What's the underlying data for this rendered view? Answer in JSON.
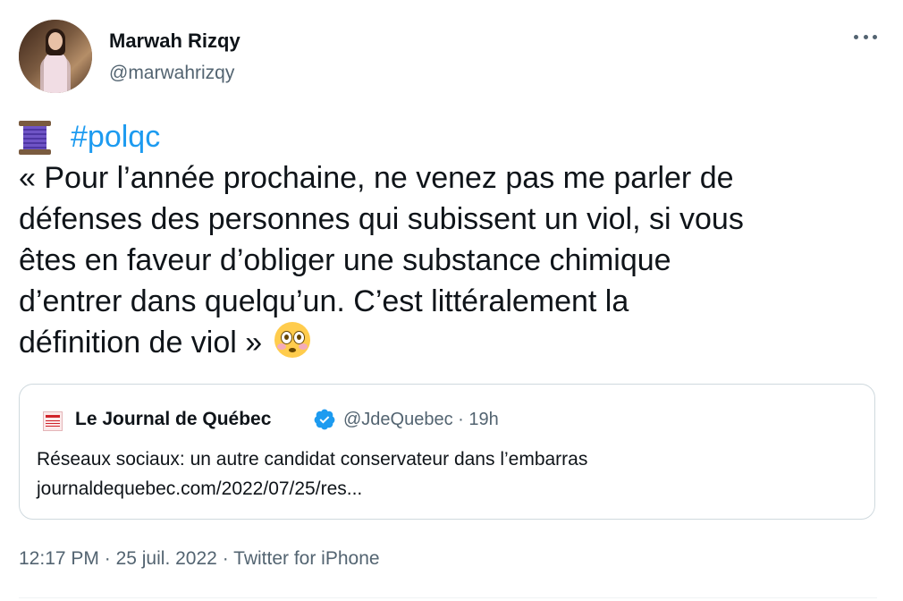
{
  "author": {
    "display_name": "Marwah Rizqy",
    "handle": "@marwahrizqy"
  },
  "tweet": {
    "emoji_lead": "spool-of-thread",
    "hashtag": "#polqc",
    "lines": [
      "« Pour l’année prochaine, ne venez pas me parler de",
      "défenses des personnes qui subissent un viol, si vous",
      "êtes en faveur d’obliger une substance chimique",
      "d’entrer dans quelqu’un. C’est littéralement la",
      "définition de viol »"
    ],
    "emoji_trail": "flushed-face"
  },
  "quote": {
    "name": "Le Journal de Québec",
    "handle": "@JdeQuebec",
    "separator": "·",
    "time": "19h",
    "text": "Réseaux sociaux: un autre candidat conservateur dans l’embarras",
    "link": "journaldequebec.com/2022/07/25/res..."
  },
  "meta": {
    "time": "12:17 PM",
    "sep1": "·",
    "date": "25 juil. 2022",
    "sep2": "·",
    "source": "Twitter for iPhone"
  },
  "colors": {
    "link": "#1d9bf0",
    "text": "#0f1419",
    "secondary": "#536471",
    "border": "#cfd9de"
  }
}
